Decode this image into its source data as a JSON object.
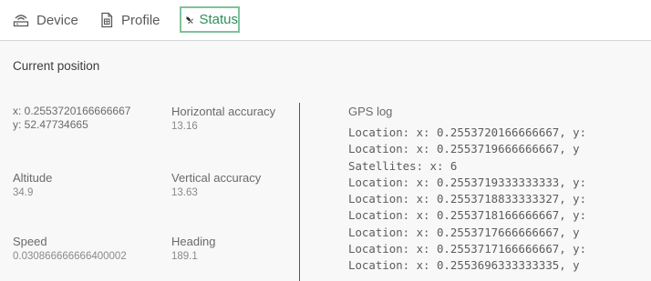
{
  "tabs": [
    {
      "label": "Device",
      "icon": "router-icon",
      "active": false
    },
    {
      "label": "Profile",
      "icon": "document-icon",
      "active": false
    },
    {
      "label": "Status",
      "icon": "satellite-icon",
      "active": true
    }
  ],
  "colors": {
    "accent": "#2f8f5a",
    "accent_border": "#7cc39a",
    "panel_bg": "#f8f8f8"
  },
  "status": {
    "section_title": "Current position",
    "position": {
      "x_text": "x: 0.2553720166666667",
      "y_text": "y: 52.47734665"
    },
    "horizontal_accuracy": {
      "label": "Horizontal accuracy",
      "value": "13.16"
    },
    "altitude": {
      "label": "Altitude",
      "value": "34.9"
    },
    "vertical_accuracy": {
      "label": "Vertical accuracy",
      "value": "13.63"
    },
    "speed": {
      "label": "Speed",
      "value": "0.030866666666400002"
    },
    "heading": {
      "label": "Heading",
      "value": "189.1"
    }
  },
  "gps_log": {
    "title": "GPS log",
    "lines": [
      "Location: x: 0.2553720166666667, y:",
      "Location: x: 0.2553719666666667, y",
      "Satellites: x: 6",
      "Location: x: 0.2553719333333333, y:",
      "Location: x: 0.2553718833333327, y:",
      "Location: x: 0.2553718166666667, y:",
      "Location: x: 0.2553717666666667, y",
      "Location: x: 0.2553717166666667, y:",
      "Location: x: 0.2553696333333335, y"
    ]
  }
}
